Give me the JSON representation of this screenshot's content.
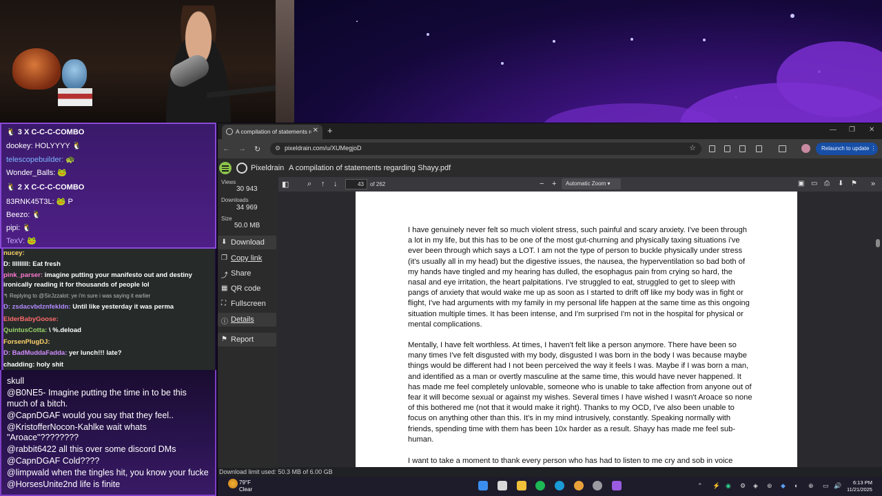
{
  "chat_top": [
    {
      "user": "",
      "text": "3 X C-C-C-COMBO",
      "color": "#ffffff",
      "emote": "🐧"
    },
    {
      "user": "dookey:",
      "text": "HOLYYYY",
      "color": "#ffffff",
      "emote": "🐧"
    },
    {
      "user": "telescopebuilder:",
      "text": "",
      "color": "#7fb6ff",
      "emote": "🐢"
    },
    {
      "user": "Wonder_Balls:",
      "text": "",
      "color": "#ffffff",
      "emote": "🐸"
    },
    {
      "user": "",
      "text": "2 X C-C-C-COMBO",
      "color": "#ffffff",
      "emote": "🐧"
    },
    {
      "user": "83RNK45T3L:",
      "text": "P",
      "color": "#ffffff",
      "emote": "🐸"
    },
    {
      "user": "Beezo:",
      "text": "",
      "color": "#ffffff",
      "emote": "🐧"
    },
    {
      "user": "pipi:",
      "text": "",
      "color": "#ffffff",
      "emote": "🐧"
    },
    {
      "user": "TexV:",
      "text": "",
      "color": "#c9a6ff",
      "emote": "🐸"
    }
  ],
  "chat_mid": [
    {
      "user": "nucey:",
      "text": "",
      "color": "#ffd36a"
    },
    {
      "user": "D: lllllllll:",
      "text": "Eat fresh",
      "color": "#ffffff"
    },
    {
      "user": "pink_parser:",
      "text": "imagine putting your manifesto out and destiny",
      "color": "#ff7ad1"
    },
    {
      "user": "",
      "text": "ironically reading it for thousands of people lol",
      "color": "#ffffff"
    },
    {
      "user": "",
      "text": "↰ Replying to @SirJzzalot: ye i'm sure i was saying it earlier",
      "color": "#bdbdbd"
    },
    {
      "user": "D: zsdacvbdznfekldn:",
      "text": "Until like yesterday it was perma",
      "color": "#b38cff"
    },
    {
      "user": "ElderBabyGoose:",
      "text": "",
      "color": "#ff6b6b"
    },
    {
      "user": "QuintusCotta:",
      "text": "\\ %.deload",
      "color": "#9bd36a"
    },
    {
      "user": "ForsenPlugDJ:",
      "text": "",
      "color": "#ffd36a"
    },
    {
      "user": "D: BadMuddaFadda:",
      "text": "yer lunch!!! late?",
      "color": "#d08bff"
    },
    {
      "user": "chadding:",
      "text": "holy shit",
      "color": "#ffffff"
    }
  ],
  "chat_bottom": [
    {
      "user": "",
      "text": "skull"
    },
    {
      "user": "@B0NE5-",
      "text": "Imagine putting the time in to be this"
    },
    {
      "user": "",
      "text": "much of a bitch."
    },
    {
      "user": "@CapnDGAF",
      "text": "would you say that they feel.."
    },
    {
      "user": "@KristofferNocon-Kahlke",
      "text": "wait whats"
    },
    {
      "user": "",
      "text": "\"Aroace\"????????"
    },
    {
      "user": "@rabbit6422",
      "text": "all this over some discord DMs"
    },
    {
      "user": "@CapnDGAF",
      "text": "Cold????"
    },
    {
      "user": "@limpwald",
      "text": "when the tingles hit, you know your fucke"
    },
    {
      "user": "@HorsesUnite2nd",
      "text": "life is finite"
    }
  ],
  "browser": {
    "tab_title": "A compilation of statements re",
    "url": "pixeldrain.com/u/XUMegjoD",
    "relaunch": "Relaunch to update"
  },
  "pixeldrain": {
    "brand": "Pixeldrain",
    "file_title": "A compilation of statements regarding Shayy.pdf",
    "stats": {
      "views_label": "Views",
      "views": "30 943",
      "downloads_label": "Downloads",
      "downloads": "34 969",
      "size_label": "Size",
      "size": "50.0 MB"
    },
    "buttons": {
      "download": "Download",
      "copy_link": "Copy link",
      "share": "Share",
      "qr_code": "QR code",
      "fullscreen": "Fullscreen",
      "details": "Details",
      "report": "Report"
    },
    "download_limit": "Download limit used: 50.3 MB of 6.00 GB"
  },
  "pdf": {
    "page": "43",
    "page_total": "of 262",
    "zoom": "Automatic Zoom",
    "paragraphs": [
      "I have genuinely never felt so much violent stress, such painful and scary anxiety. I've been through a lot in my life, but this has to be one of the most gut-churning and physically taxing situations i've ever been through which says a LOT. I am not the type of person to buckle physically under stress (it's usually all in my head) but the digestive issues, the nausea, the hyperventilation so bad both of my hands have tingled and my hearing has dulled, the esophagus pain from crying so hard, the nasal and eye irritation, the heart palpitations. I've struggled to eat, struggled to get to sleep with pangs of anxiety that would wake me up as soon as I started to drift off like my body was in fight or flight, I've had arguments with my family in my personal life happen at the same time as this ongoing situation multiple times. It has been intense, and I'm surprised I'm not in the hospital for physical or mental complications.",
      "Mentally, I have felt worthless. At times, I haven't felt like a person anymore. There have been so many times I've felt disgusted with my body, disgusted I was born in the body I was because maybe things would be different had I not been perceived the way it feels I was. Maybe if I was born a man, and identified as a man or overtly masculine at the same time, this would have never happened. It has made me feel completely unlovable, someone who is unable to take affection from anyone out of fear it will become sexual or against my wishes. Several times I have wished I wasn't Aroace so none of this bothered me (not that it would make it right). Thanks to my OCD, I've also been unable to focus on anything other than this. It's in my mind intrusively, constantly. Speaking normally with friends, spending time with them has been 10x harder as a result. Shayy has made me feel sub-human.",
      "I want to take a moment to thank every person who has had to listen to me cry and sob in voice"
    ]
  },
  "taskbar": {
    "temp": "79°F",
    "weather": "Clear",
    "time": "6:13 PM",
    "date": "11/21/2025"
  }
}
